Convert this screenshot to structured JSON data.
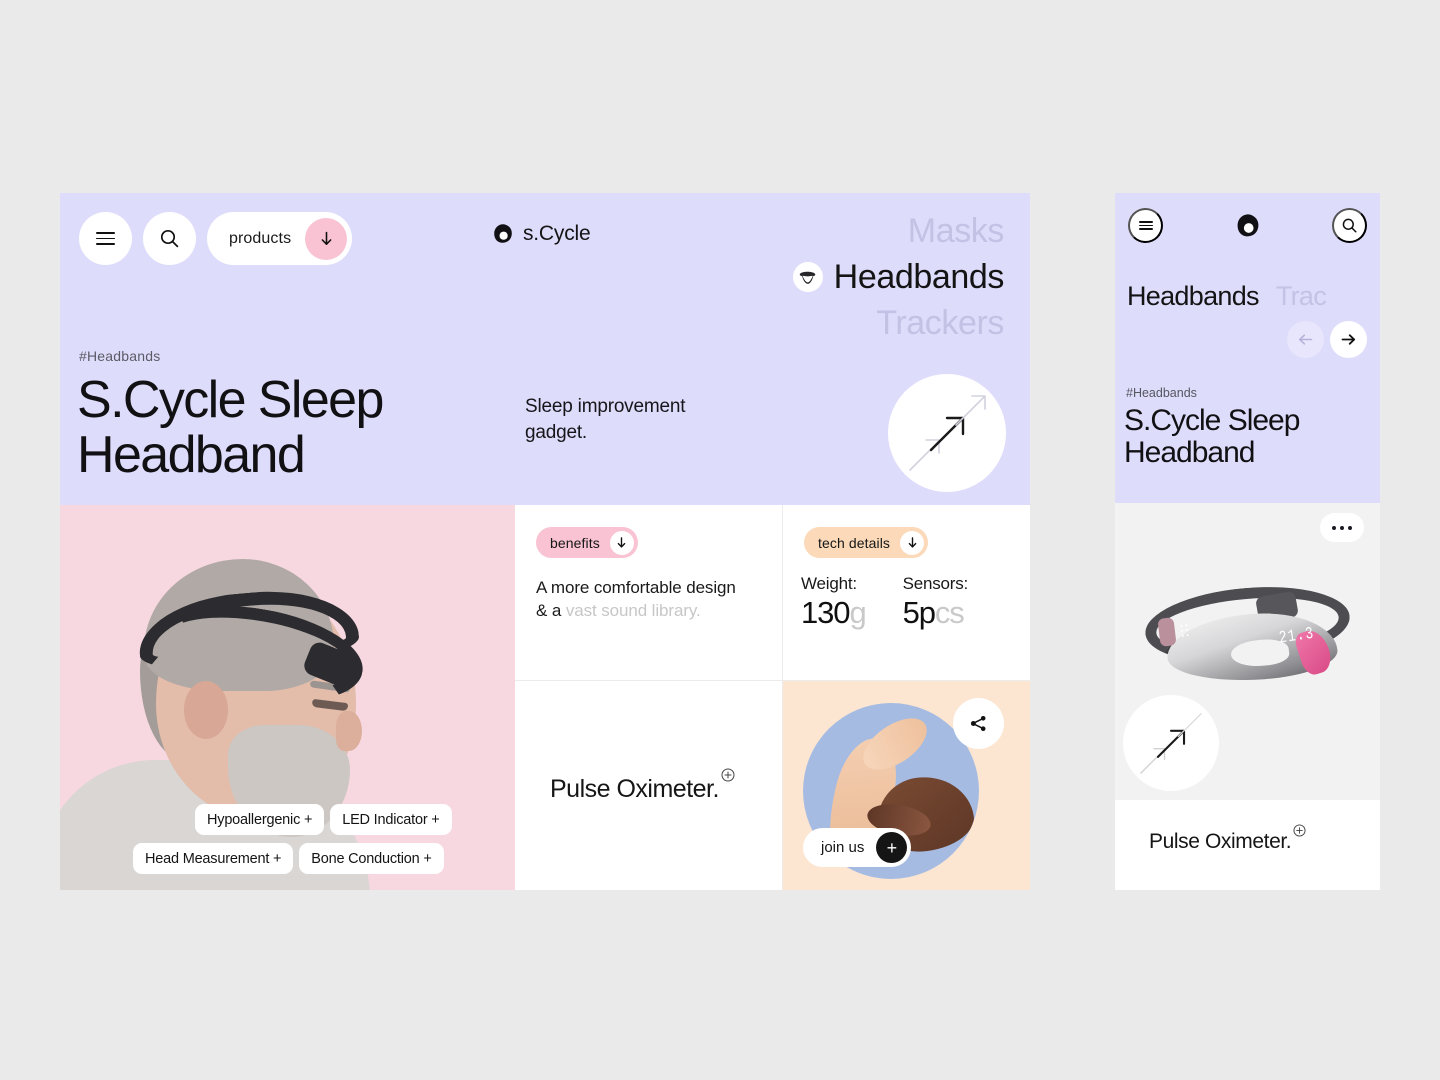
{
  "brand": {
    "name": "s.Cycle",
    "logo_icon": "scycle-blob-logo"
  },
  "desktop": {
    "header": {
      "menu_icon": "hamburger-menu-icon",
      "search_icon": "search-icon",
      "products_label": "products",
      "products_arrow_icon": "arrow-down-icon"
    },
    "nav": [
      {
        "label": "Masks",
        "active": false
      },
      {
        "label": "Headbands",
        "active": true,
        "icon": "headband-icon"
      },
      {
        "label": "Trackers",
        "active": false
      }
    ],
    "hero": {
      "hashtag": "#Headbands",
      "title_line1": "S.Cycle Sleep",
      "title_line2": "Headband",
      "subtitle_line1": "Sleep improvement",
      "subtitle_line2": "gadget.",
      "cta_icon": "arrow-up-right-icon"
    },
    "photo": {
      "alt_name": "man-wearing-sleep-headband",
      "feature_tags_row1": [
        "Hypoallergenic +",
        "LED Indicator +"
      ],
      "feature_tags_row2": [
        "Head Measurement +",
        "Bone Conduction +"
      ]
    },
    "benefits": {
      "pill_label": "benefits",
      "pill_arrow_icon": "arrow-down-icon",
      "text_strong": "A more comfortable design & a ",
      "text_muted": "vast sound library."
    },
    "tech": {
      "pill_label": "tech details",
      "pill_arrow_icon": "arrow-down-icon",
      "specs": [
        {
          "key": "Weight:",
          "value": "130",
          "unit": "g"
        },
        {
          "key": "Sensors:",
          "value": "5p",
          "unit": "cs"
        }
      ]
    },
    "oximeter": {
      "title": "Pulse Oximeter.",
      "plus_icon": "plus-circle-icon"
    },
    "join": {
      "share_icon": "share-icon",
      "label": "join us",
      "plus_label": "+",
      "photo_alt": "two-hands-reaching"
    }
  },
  "mobile": {
    "header": {
      "menu_icon": "hamburger-menu-icon",
      "logo_icon": "scycle-blob-logo",
      "search_icon": "search-icon"
    },
    "tabs": [
      {
        "label": "Headbands",
        "active": true
      },
      {
        "label": "Trac",
        "active": false
      }
    ],
    "arrows": {
      "prev_icon": "arrow-left-icon",
      "next_icon": "arrow-right-icon"
    },
    "hero": {
      "hashtag": "#Headbands",
      "title_line1": "S.Cycle Sleep",
      "title_line2": "Headband"
    },
    "product": {
      "more_icon": "ellipsis-icon",
      "device_alt": "sleep-headband-device",
      "device_display": "21.3",
      "cta_icon": "arrow-up-right-icon"
    },
    "oximeter": {
      "title": "Pulse Oximeter.",
      "plus_icon": "plus-circle-icon"
    }
  },
  "colors": {
    "page_bg": "#eaeaea",
    "lavender": "#dedcfb",
    "pink": "#f7d7e0",
    "pill_pink": "#f9c3d3",
    "peach_card": "#fce6d2",
    "pill_peach": "#fbd9b9",
    "blue_circle": "#a6bbe2",
    "ink": "#141414",
    "muted": "#c4c2e5"
  }
}
